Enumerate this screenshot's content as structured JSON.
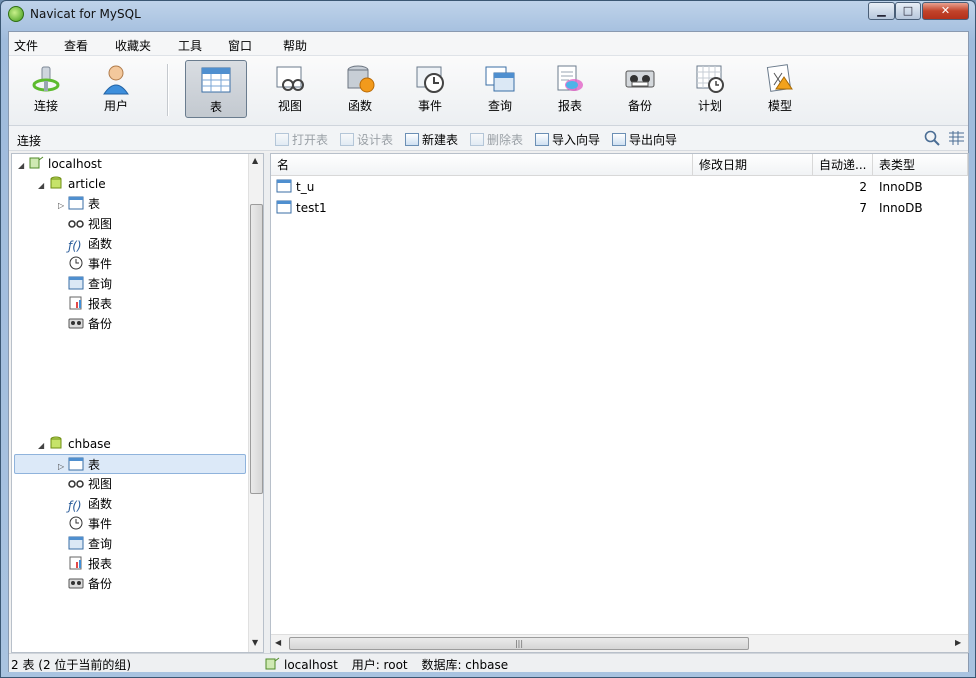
{
  "window": {
    "title": "Navicat for MySQL"
  },
  "menu": [
    "文件",
    "查看",
    "收藏夹",
    "工具",
    "窗口",
    "帮助"
  ],
  "toolbar": {
    "connect": "连接",
    "user": "用户",
    "buttons": [
      "表",
      "视图",
      "函数",
      "事件",
      "查询",
      "报表",
      "备份",
      "计划",
      "模型"
    ],
    "active": "表"
  },
  "subbar": {
    "left_label": "连接",
    "actions": [
      {
        "label": "打开表",
        "enabled": false
      },
      {
        "label": "设计表",
        "enabled": false
      },
      {
        "label": "新建表",
        "enabled": true
      },
      {
        "label": "删除表",
        "enabled": false
      },
      {
        "label": "导入向导",
        "enabled": true
      },
      {
        "label": "导出向导",
        "enabled": true
      }
    ]
  },
  "tree": {
    "server": "localhost",
    "databases": [
      {
        "name": "article",
        "children": [
          "表",
          "视图",
          "函数",
          "事件",
          "查询",
          "报表",
          "备份"
        ]
      },
      {
        "name": "chbase",
        "children": [
          "表",
          "视图",
          "函数",
          "事件",
          "查询",
          "报表",
          "备份"
        ],
        "selected_child": "表"
      }
    ]
  },
  "table": {
    "columns": [
      "名",
      "修改日期",
      "自动递...",
      "表类型"
    ],
    "rows": [
      {
        "name": "t_u",
        "modified": "",
        "auto_inc": "2",
        "engine": "InnoDB"
      },
      {
        "name": "test1",
        "modified": "",
        "auto_inc": "7",
        "engine": "InnoDB"
      }
    ]
  },
  "status": {
    "left": "2 表 (2 位于当前的组)",
    "connection": "localhost",
    "user": "用户: root",
    "database": "数据库: chbase"
  }
}
